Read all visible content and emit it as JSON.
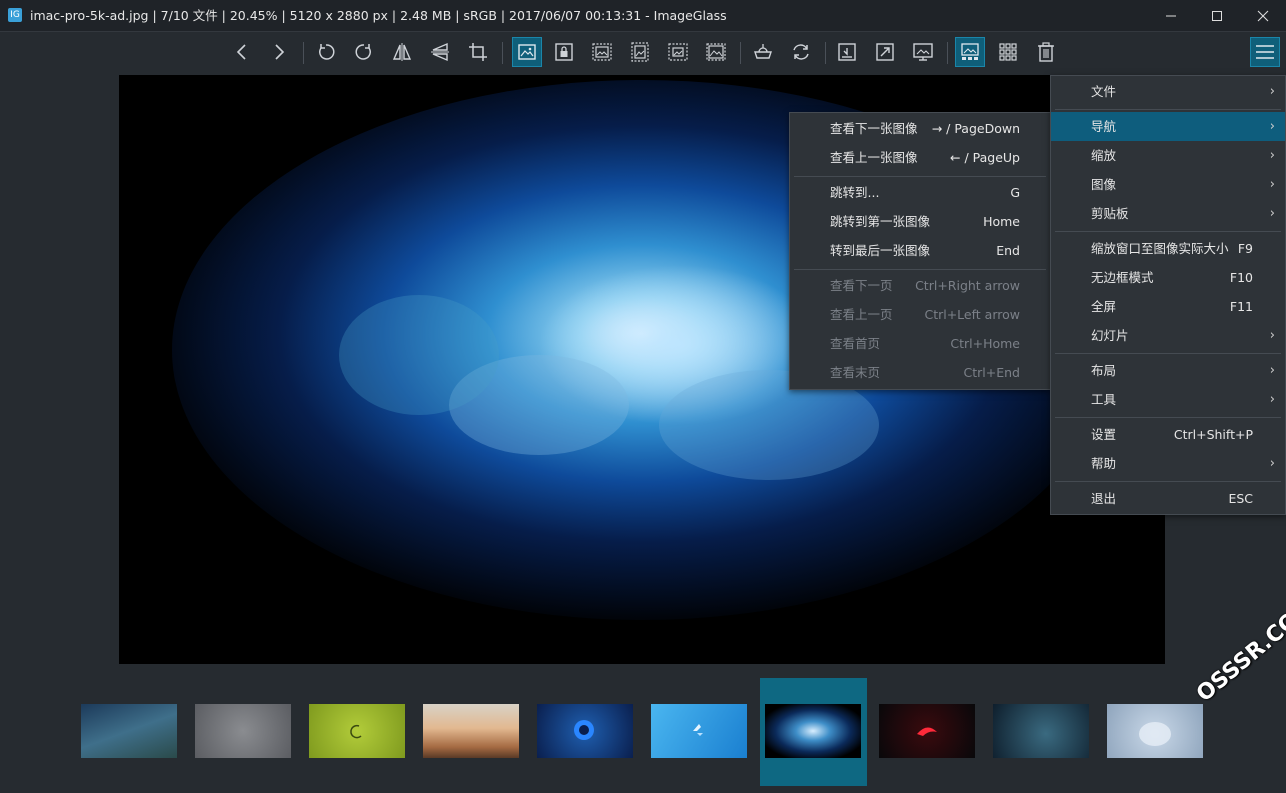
{
  "window": {
    "title": "imac-pro-5k-ad.jpg  |  7/10 文件  |  20.45%  |  5120 x 2880 px  |  2.48 MB  |  sRGB  |  2017/06/07 00:13:31  - ImageGlass",
    "app_icon_text": "IG"
  },
  "toolbar": {
    "items": [
      "previous-image",
      "next-image",
      "rotate-left",
      "rotate-right",
      "flip-horizontal",
      "flip-vertical",
      "crop",
      "auto-zoom",
      "lock-zoom",
      "scale-to-width",
      "scale-to-height",
      "scale-to-fit",
      "scale-to-fill",
      "open-with",
      "refresh",
      "open-location",
      "fullscreen",
      "set-wallpaper",
      "thumbnail-bar",
      "gallery",
      "delete"
    ],
    "accent": "#1a86aa"
  },
  "main_menu": {
    "items": [
      {
        "label": "文件",
        "shortcut": "",
        "submenu": true
      },
      {
        "label": "导航",
        "shortcut": "",
        "submenu": true
      },
      {
        "label": "缩放",
        "shortcut": "",
        "submenu": true
      },
      {
        "label": "图像",
        "shortcut": "",
        "submenu": true
      },
      {
        "label": "剪贴板",
        "shortcut": "",
        "submenu": true
      },
      {
        "label": "缩放窗口至图像实际大小",
        "shortcut": "F9",
        "submenu": false
      },
      {
        "label": "无边框模式",
        "shortcut": "F10",
        "submenu": false
      },
      {
        "label": "全屏",
        "shortcut": "F11",
        "submenu": false
      },
      {
        "label": "幻灯片",
        "shortcut": "",
        "submenu": true
      },
      {
        "label": "布局",
        "shortcut": "",
        "submenu": true
      },
      {
        "label": "工具",
        "shortcut": "",
        "submenu": true
      },
      {
        "label": "设置",
        "shortcut": "Ctrl+Shift+P",
        "submenu": false
      },
      {
        "label": "帮助",
        "shortcut": "",
        "submenu": true
      },
      {
        "label": "退出",
        "shortcut": "ESC",
        "submenu": false
      }
    ]
  },
  "nav_submenu": {
    "items": [
      {
        "label": "查看下一张图像",
        "shortcut": "→ / PageDown",
        "disabled": false
      },
      {
        "label": "查看上一张图像",
        "shortcut": "← / PageUp",
        "disabled": false
      },
      {
        "label": "跳转到...",
        "shortcut": "G",
        "disabled": false
      },
      {
        "label": "跳转到第一张图像",
        "shortcut": "Home",
        "disabled": false
      },
      {
        "label": "转到最后一张图像",
        "shortcut": "End",
        "disabled": false
      },
      {
        "label": "查看下一页",
        "shortcut": "Ctrl+Right arrow",
        "disabled": true
      },
      {
        "label": "查看上一页",
        "shortcut": "Ctrl+Left arrow",
        "disabled": true
      },
      {
        "label": "查看首页",
        "shortcut": "Ctrl+Home",
        "disabled": true
      },
      {
        "label": "查看末页",
        "shortcut": "Ctrl+End",
        "disabled": true
      }
    ]
  },
  "thumbnails": {
    "count": 10,
    "selected_index": 6
  },
  "watermark": "OSSSR.COM"
}
